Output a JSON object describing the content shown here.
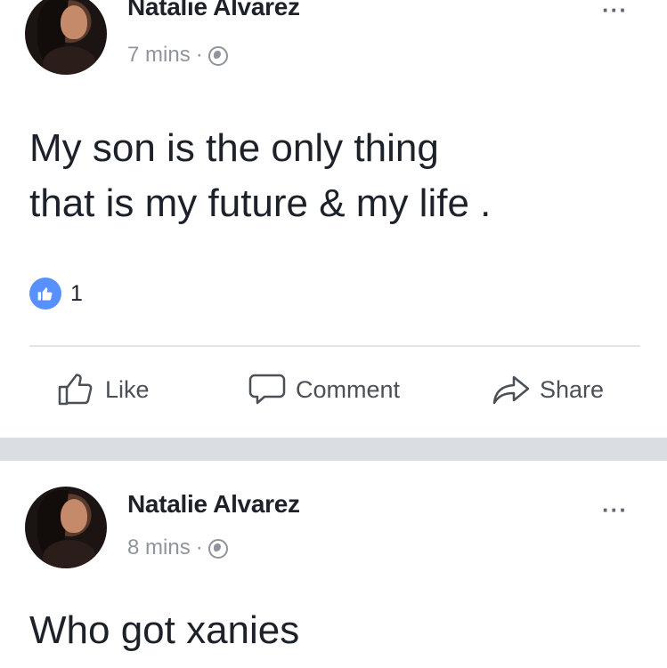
{
  "posts": [
    {
      "author": "Natalie Alvarez",
      "time": "7 mins",
      "dot": "·",
      "privacy_icon": "globe-icon",
      "more": "···",
      "text": "My son is the only thing\nthat is my future & my life .",
      "reactions": {
        "icon": "like-reaction-icon",
        "count": "1"
      },
      "actions": {
        "like": "Like",
        "comment": "Comment",
        "share": "Share"
      }
    },
    {
      "author": "Natalie Alvarez",
      "time": "8 mins",
      "dot": "·",
      "privacy_icon": "globe-icon",
      "more": "···",
      "text": "Who got xanies"
    }
  ],
  "colors": {
    "like_badge": "#5890ff",
    "meta_gray": "#90949c",
    "action_gray": "#4b4f56",
    "separator": "#dadde1"
  }
}
